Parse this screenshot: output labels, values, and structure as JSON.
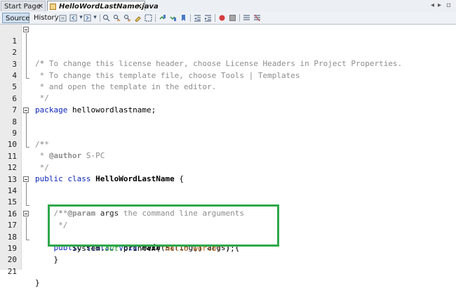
{
  "tabs": [
    {
      "label": "Start Page",
      "active": false
    },
    {
      "label": "HelloWordLastName.java",
      "active": true
    }
  ],
  "toolbar": {
    "source_label": "Source",
    "history_label": "History"
  },
  "editor": {
    "lines": [
      {
        "n": "1",
        "text": "/*"
      },
      {
        "n": "2",
        "text": " * To change this license header, choose License Headers in Project Properties."
      },
      {
        "n": "3",
        "text": " * To change this template file, choose Tools | Templates"
      },
      {
        "n": "4",
        "text": " * and open the template in the editor."
      },
      {
        "n": "5",
        "text": " */"
      },
      {
        "n": "6",
        "text": "package hellowordlastname;"
      },
      {
        "n": "7",
        "text": ""
      },
      {
        "n": "8",
        "text": "/**"
      },
      {
        "n": "9",
        "text": " *"
      },
      {
        "n": "10",
        "text": " * @author S-PC"
      },
      {
        "n": "11",
        "text": " */"
      },
      {
        "n": "12",
        "text": "public class HelloWordLastName {"
      },
      {
        "n": "13",
        "text": ""
      },
      {
        "n": "14",
        "text": "    /**"
      },
      {
        "n": "15",
        "text": "     * @param args the command line arguments"
      },
      {
        "n": "16",
        "text": "     */"
      },
      {
        "n": "17",
        "text": "    public static void main(String[] args) {"
      },
      {
        "n": "18",
        "text": "        System.out.println(\"Hello world!\");"
      },
      {
        "n": "19",
        "text": "    }"
      },
      {
        "n": "20",
        "text": ""
      },
      {
        "n": "21",
        "text": "}"
      }
    ],
    "tokens": {
      "c1": "/*",
      "c2": " * To change this license header, choose License Headers in Project Properties.",
      "c3": " * To change this template file, choose Tools | Templates",
      "c4": " * and open the template in the editor.",
      "c5": " */",
      "pkg_kw": "package",
      "pkg_name": " hellowordlastname;",
      "d8": "/**",
      "d9": " *",
      "d10a": " * ",
      "d10b": "@author",
      "d10c": " S-PC",
      "d11": " */",
      "cls_kw": "public class",
      "cls_name": "HelloWordLastName",
      "cls_brace": " {",
      "d14": "    /**",
      "d15a": "     * ",
      "d15b": "@param",
      "d15c": " args",
      "d15d": " the command line arguments",
      "d16": "     */",
      "m_kw": "    public static void",
      "m_name": "main",
      "m_rest": "(String[] args) {",
      "s_pre": "        System.",
      "s_field": "out",
      "s_mid": ".println(",
      "s_str": "\"Hello world!\"",
      "s_end": ");",
      "b19": "    }",
      "b21": "}"
    }
  },
  "colors": {
    "keyword": "#0b24b8",
    "comment": "#8d8d8d",
    "string": "#b1560d",
    "field": "#239628",
    "highlight": "#2ea84b"
  }
}
